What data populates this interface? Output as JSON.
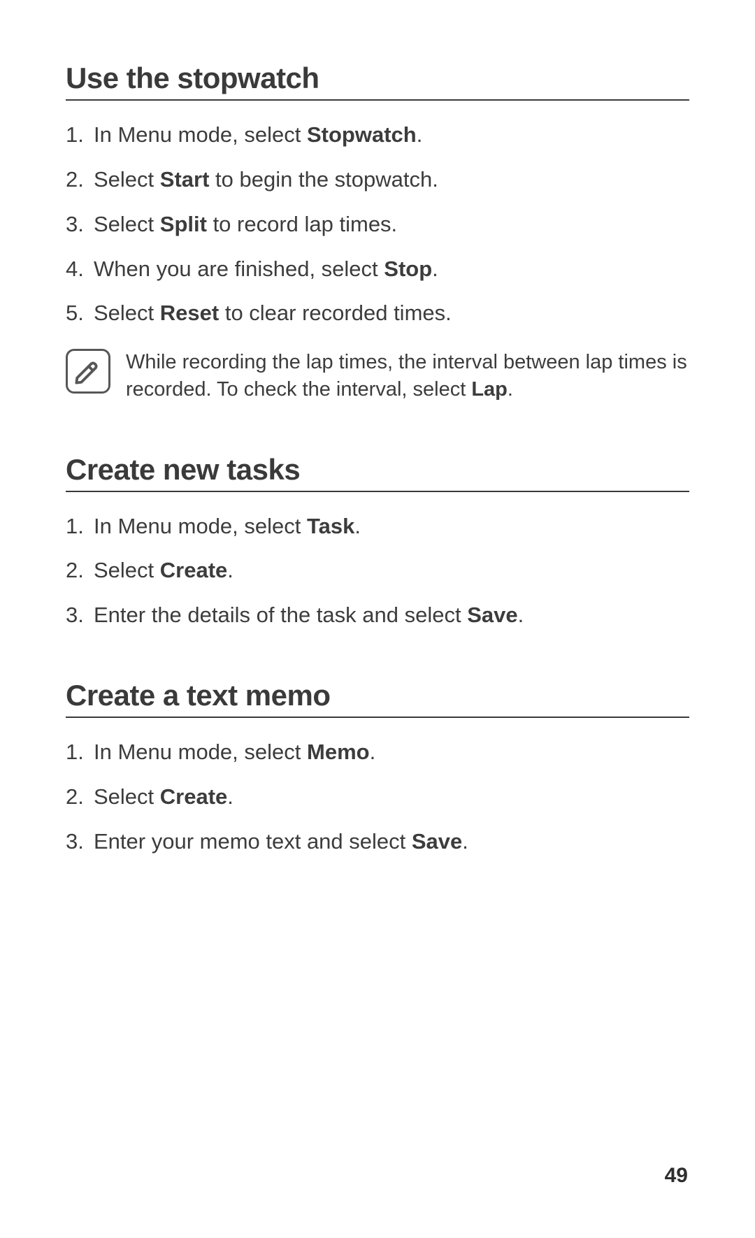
{
  "section1": {
    "title": "Use the stopwatch",
    "steps": [
      {
        "pre": "In Menu mode, select ",
        "bold": "Stopwatch",
        "post": "."
      },
      {
        "pre": "Select ",
        "bold": "Start",
        "post": " to begin the stopwatch."
      },
      {
        "pre": "Select ",
        "bold": "Split",
        "post": " to record lap times."
      },
      {
        "pre": "When you are finished, select ",
        "bold": "Stop",
        "post": "."
      },
      {
        "pre": "Select ",
        "bold": "Reset",
        "post": " to clear recorded times."
      }
    ],
    "note": {
      "pre": "While recording the lap times, the interval between lap times is recorded. To check the interval, select ",
      "bold": "Lap",
      "post": "."
    }
  },
  "section2": {
    "title": "Create new tasks",
    "steps": [
      {
        "pre": "In Menu mode, select ",
        "bold": "Task",
        "post": "."
      },
      {
        "pre": "Select ",
        "bold": "Create",
        "post": "."
      },
      {
        "pre": "Enter the details of the task and select ",
        "bold": "Save",
        "post": "."
      }
    ]
  },
  "section3": {
    "title": "Create a text memo",
    "steps": [
      {
        "pre": "In Menu mode, select ",
        "bold": "Memo",
        "post": "."
      },
      {
        "pre": "Select ",
        "bold": "Create",
        "post": "."
      },
      {
        "pre": "Enter your memo text and select ",
        "bold": "Save",
        "post": "."
      }
    ]
  },
  "page_number": "49"
}
